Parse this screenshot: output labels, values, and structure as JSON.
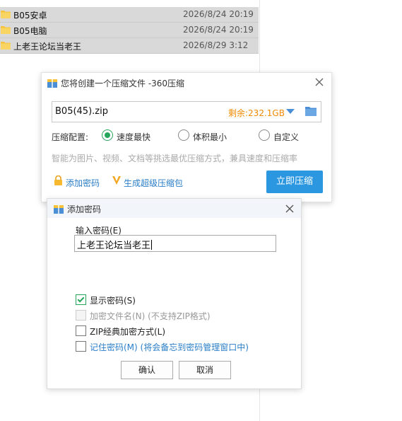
{
  "files": [
    {
      "name": "B05安卓",
      "date": "2026/8/24 20:19"
    },
    {
      "name": "B05电脑",
      "date": "2026/8/24 20:19"
    },
    {
      "name": "上老王论坛当老王",
      "date": "2026/8/29 3:12"
    }
  ],
  "compress_dialog": {
    "title": "您将创建一个压缩文件 -360压缩",
    "filename": "B05(45).zip",
    "remaining": "剩余:232.1GB",
    "config_label": "压缩配置:",
    "options": [
      "速度最快",
      "体积最小",
      "自定义"
    ],
    "selected_option": "速度最快",
    "hint": "智能为图片、视频、文档等挑选最优压缩方式，兼具速度和压缩率",
    "add_password_link": "添加密码",
    "super_package_link": "生成超级压缩包",
    "compress_button": "立即压缩"
  },
  "password_dialog": {
    "title": "添加密码",
    "input_label": "输入密码(E)",
    "password_value": "上老王论坛当老王",
    "checkboxes": [
      {
        "label": "显示密码(S)",
        "checked": true,
        "disabled": false
      },
      {
        "label": "加密文件名(N)  (不支持ZIP格式)",
        "checked": false,
        "disabled": true
      },
      {
        "label": "ZIP经典加密方式(L)",
        "checked": false,
        "disabled": false
      },
      {
        "label": "记住密码(M)  (将会备忘到密码管理窗口中)",
        "checked": false,
        "disabled": false
      }
    ],
    "ok_button": "确认",
    "cancel_button": "取消"
  },
  "colors": {
    "accent_green": "#26a65b",
    "accent_blue": "#2b97e0",
    "link_blue": "#2a7ec8",
    "remaining_orange": "#f08a00",
    "folder_yellow": "#f5c23a"
  }
}
